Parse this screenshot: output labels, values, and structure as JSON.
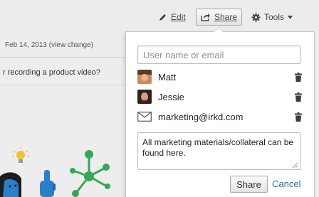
{
  "toolbar": {
    "edit_label": "Edit",
    "share_label": "Share",
    "tools_label": "Tools"
  },
  "background": {
    "meta_date": "Feb 14, 2013",
    "meta_link": "(view change)",
    "question_text": "r recording a product video?"
  },
  "share_panel": {
    "search_placeholder": "User name or email",
    "search_value": "",
    "members": [
      {
        "name": "Matt",
        "icon": "avatar"
      },
      {
        "name": "Jessie",
        "icon": "avatar"
      },
      {
        "name": "marketing@irkd.com",
        "icon": "mail-icon"
      }
    ],
    "note_text": "All marketing materials/collateral can be found here.",
    "share_button": "Share",
    "cancel_link": "Cancel"
  },
  "colors": {
    "link_blue": "#2b6fb6",
    "illustration_green": "#35a853",
    "illustration_blue": "#2a80c8",
    "bulb_yellow": "#f1c232"
  }
}
